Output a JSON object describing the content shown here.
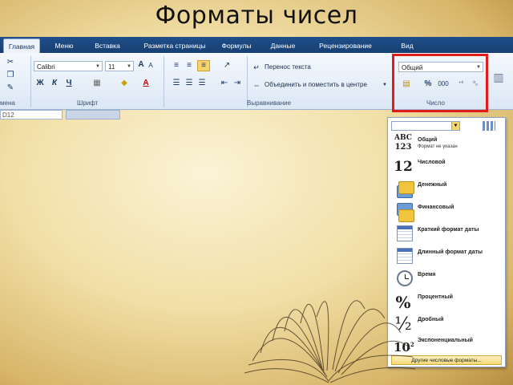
{
  "slide": {
    "title": "Форматы чисел"
  },
  "ribbon": {
    "tabs": [
      "Главная",
      "Меню",
      "Вставка",
      "Разметка страницы",
      "Формулы",
      "Данные",
      "Рецензирование",
      "Вид"
    ],
    "active_tab": "Главная",
    "font_name": "Calibri",
    "font_size": "11",
    "bold_label": "Ж",
    "italic_label": "К",
    "underline_label": "Ч",
    "font_color_label": "A",
    "wrap_text": "Перенос текста",
    "merge_center": "Объединить и поместить в центре",
    "number_format": "Общий",
    "percent_symbol": "%",
    "thousands_symbol": "000",
    "groups": {
      "clipboard_partial": "мена",
      "font": "Шрифт",
      "alignment": "Выравнивание",
      "number": "Число"
    },
    "highlight_color": "#e21b1b"
  },
  "sheet": {
    "namebox": "D12"
  },
  "number_dropdown": {
    "items": [
      {
        "name": "Общий",
        "sub": "Формат не указан",
        "icon": "abc-123-icon"
      },
      {
        "name": "Числовой",
        "icon": "number-12-icon"
      },
      {
        "name": "Денежный",
        "icon": "money-icon"
      },
      {
        "name": "Финансовый",
        "icon": "accounting-icon"
      },
      {
        "name": "Краткий формат даты",
        "icon": "calendar-short-icon"
      },
      {
        "name": "Длинный формат даты",
        "icon": "calendar-long-icon"
      },
      {
        "name": "Время",
        "icon": "clock-icon"
      },
      {
        "name": "Процентный",
        "icon": "percent-icon"
      },
      {
        "name": "Дробный",
        "icon": "fraction-icon"
      },
      {
        "name": "Экспоненциальный",
        "icon": "scientific-icon"
      }
    ],
    "icon_text": {
      "abc": "ABC",
      "n123": "123",
      "n12": "12",
      "pct": "%",
      "half": "½",
      "ten": "10",
      "exp": "2"
    },
    "more_formats": "Другие числовые форматы..."
  }
}
